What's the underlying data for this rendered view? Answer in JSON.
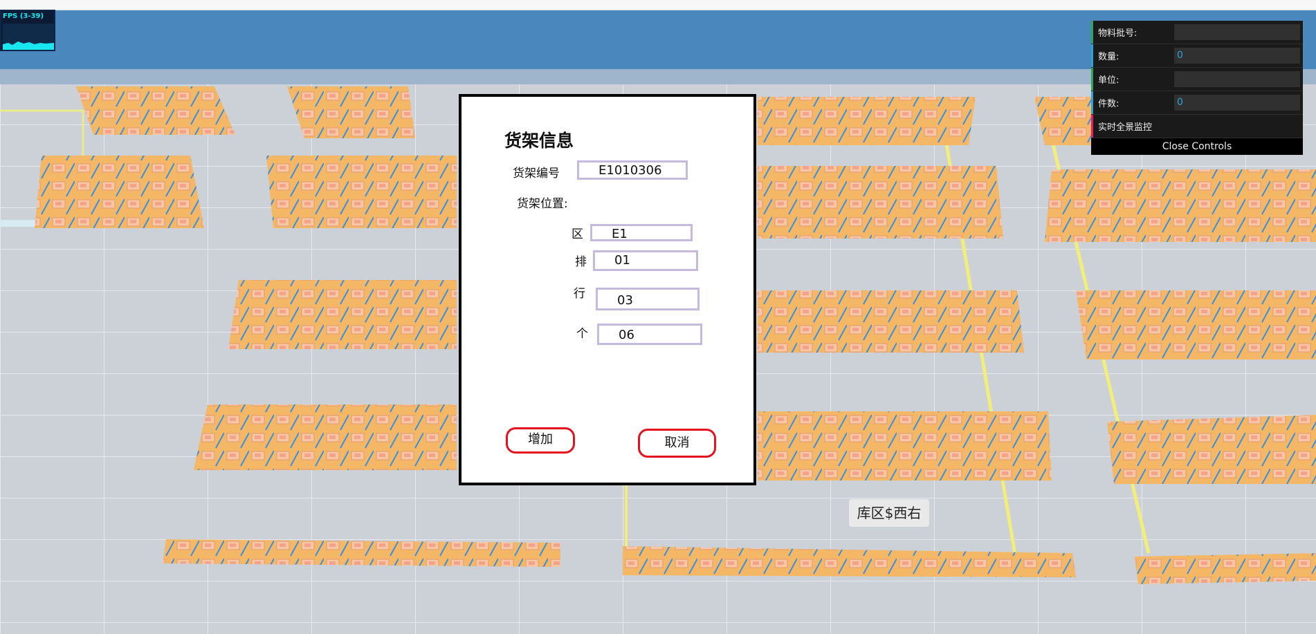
{
  "controls": {
    "rows": [
      {
        "label": "物料批号:",
        "value": "",
        "accent": "#2fa35a"
      },
      {
        "label": "数量:",
        "value": "0",
        "accent": "#2fa1d6"
      },
      {
        "label": "单位:",
        "value": "",
        "accent": "#2fa35a"
      },
      {
        "label": "件数:",
        "value": "0",
        "accent": "#2fa1d6"
      },
      {
        "label": "实时全景监控",
        "value": null,
        "accent": "#e61d5f"
      }
    ],
    "close_label": "Close Controls"
  },
  "fps": {
    "label": "FPS (3-39)"
  },
  "dialog": {
    "title": "货架信息",
    "shelf_no_label": "货架编号",
    "shelf_no_value": "E1010306",
    "position_label": "货架位置:",
    "zone_label": "区",
    "zone_value": "E1",
    "row_label": "排",
    "row_value": "01",
    "line_label": "行",
    "line_value": "03",
    "unit_label": "个",
    "unit_value": "06",
    "add_label": "增加",
    "cancel_label": "取消"
  },
  "area_label": "库区$西右",
  "colors": {
    "accent_red": "#e5111e",
    "field_border": "#c5b9e0",
    "gui_value": "#2fa1d6",
    "fps": "#18e7f0"
  }
}
